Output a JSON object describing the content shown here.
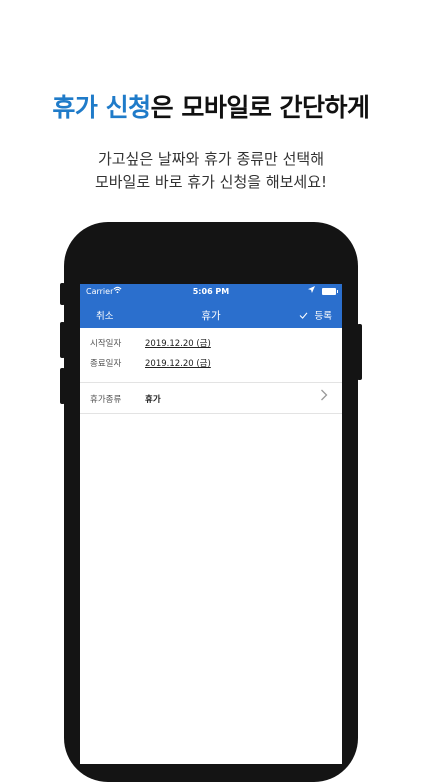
{
  "headline": {
    "accent": "휴가 신청",
    "rest": "은 모바일로 간단하게"
  },
  "subtitle": {
    "line1": "가고싶은 날짜와 휴가 종류만 선택해",
    "line2": "모바일로 바로 휴가 신청을 해보세요!"
  },
  "statusbar": {
    "carrier": "Carrier",
    "time": "5:06 PM"
  },
  "navbar": {
    "cancel": "취소",
    "title": "휴가",
    "submit": "등록"
  },
  "form": {
    "start_label": "시작일자",
    "start_value": "2019.12.20 (금)",
    "end_label": "종료일자",
    "end_value": "2019.12.20 (금)",
    "type_label": "휴가종류",
    "type_value": "휴가"
  },
  "icons": {
    "wifi": "wifi-icon",
    "location": "location-arrow-icon",
    "battery": "battery-icon",
    "check": "checkmark-icon",
    "chevron": "chevron-right-icon"
  },
  "colors": {
    "accent": "#1f7bc9",
    "navbar": "#2b6fcd"
  }
}
